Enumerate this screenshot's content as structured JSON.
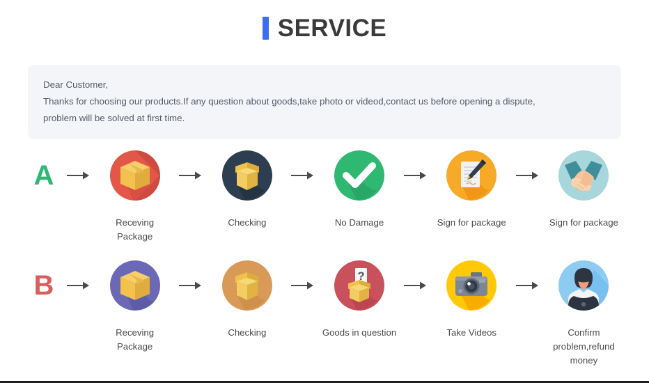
{
  "header": {
    "accent_color": "#3b6ef5",
    "title": "SERVICE",
    "accent_bar_icon": "vertical-bar-icon"
  },
  "notice": {
    "background_color": "#f4f5f9",
    "lines": [
      "Dear Customer,",
      "Thanks for choosing our products.If any question about goods,take photo or videod,contact us before opening a dispute,",
      "problem will be solved at first time."
    ]
  },
  "flows": [
    {
      "badge": "A",
      "badge_color": "#2eb872",
      "steps": [
        {
          "label": "Receving Package",
          "icon": "package-box-icon",
          "circle_color": "#e3564a"
        },
        {
          "label": "Checking",
          "icon": "open-box-icon",
          "circle_color": "#2c3e50"
        },
        {
          "label": "No Damage",
          "icon": "check-mark-icon",
          "circle_color": "#2eb872"
        },
        {
          "label": "Sign for package",
          "icon": "document-pen-icon",
          "circle_color": "#f7a928"
        },
        {
          "label": "Sign for package",
          "icon": "handshake-icon",
          "circle_color": "#a7d7dc"
        }
      ]
    },
    {
      "badge": "B",
      "badge_color": "#d95e5e",
      "steps": [
        {
          "label": "Receving Package",
          "icon": "package-box-icon",
          "circle_color": "#6b68b5"
        },
        {
          "label": "Checking",
          "icon": "open-box-icon",
          "circle_color": "#d99a57"
        },
        {
          "label": "Goods in question",
          "icon": "question-box-icon",
          "circle_color": "#c9515c"
        },
        {
          "label": "Take Videos",
          "icon": "camera-icon",
          "circle_color": "#ffc907"
        },
        {
          "label": "Confirm problem,refund money",
          "icon": "support-person-icon",
          "circle_color": "#8ecbf2"
        }
      ]
    }
  ],
  "arrow": {
    "icon": "arrow-right-icon",
    "color": "#4a4a4a"
  }
}
